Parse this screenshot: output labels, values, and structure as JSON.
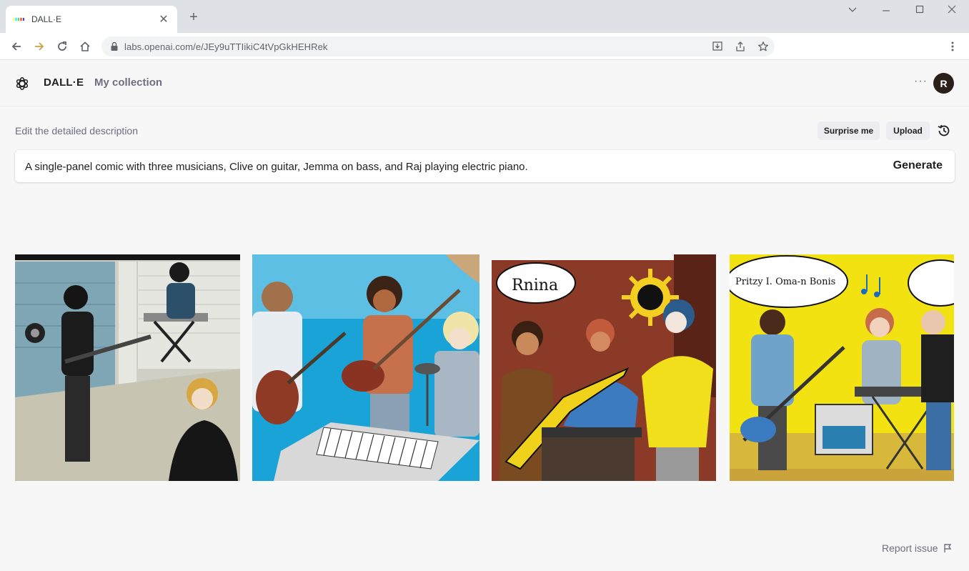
{
  "browser": {
    "tab_title": "DALL·E",
    "tab_close": "✕",
    "new_tab": "+",
    "url": "labs.openai.com/e/JEy9uTTIikiC4tVpGkHEHRek"
  },
  "header": {
    "brand": "DALL·E",
    "nav_link": "My collection",
    "more": "···",
    "avatar_initial": "R"
  },
  "prompt": {
    "label": "Edit the detailed description",
    "surprise_label": "Surprise me",
    "upload_label": "Upload",
    "value": "A single-panel comic with three musicians, Clive on guitar, Jemma on bass, and Raj playing electric piano.",
    "generate_label": "Generate"
  },
  "images": [
    {
      "speech_text": ""
    },
    {
      "speech_text": ""
    },
    {
      "speech_text": "Rnina"
    },
    {
      "speech_text": "Pritzy I. Oma-n Bonis"
    }
  ],
  "footer": {
    "report_label": "Report issue"
  },
  "colors": {
    "page_bg": "#f7f7f8",
    "text_primary": "#202123",
    "text_secondary": "#6e6e80",
    "pill_bg": "#ececf1"
  }
}
